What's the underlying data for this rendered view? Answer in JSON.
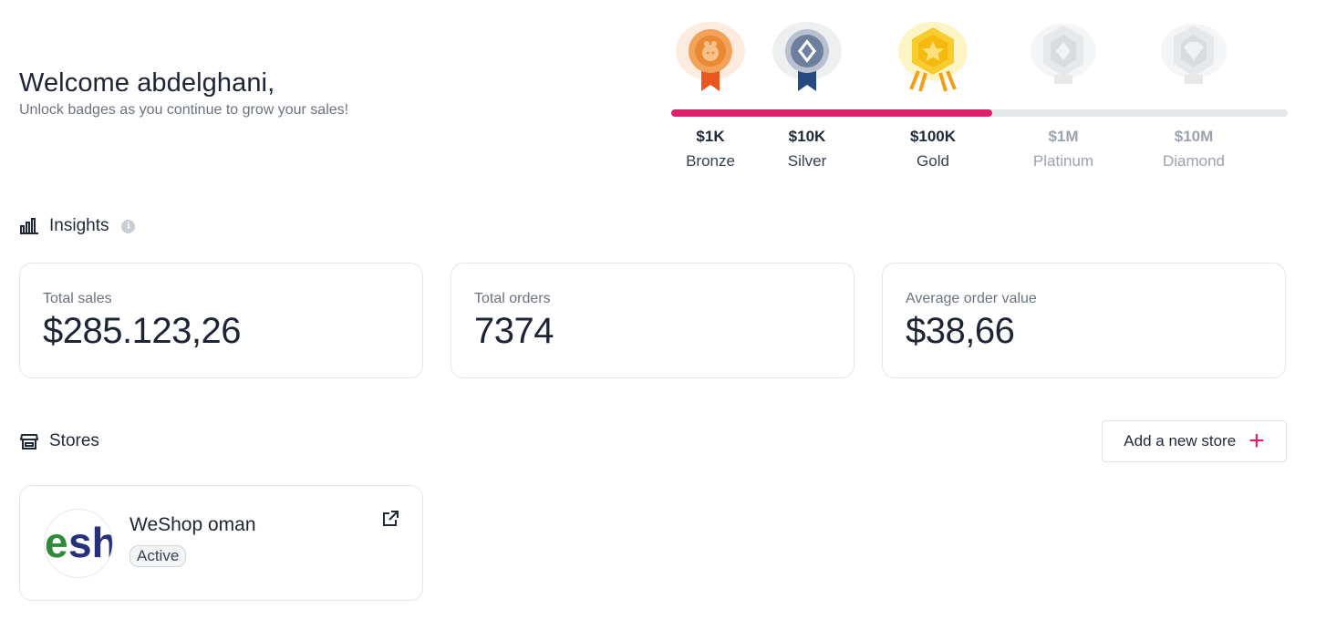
{
  "welcome": {
    "title": "Welcome abdelghani,",
    "subtitle": "Unlock badges as you continue to grow your sales!"
  },
  "badges": {
    "progress_fraction": 0.52,
    "items": [
      {
        "amount": "$1K",
        "tier": "Bronze",
        "unlocked": true,
        "icon": "bronze-medal-icon",
        "color": "#ec8f3d"
      },
      {
        "amount": "$10K",
        "tier": "Silver",
        "unlocked": true,
        "icon": "silver-medal-icon",
        "color": "#7b8aa6"
      },
      {
        "amount": "$100K",
        "tier": "Gold",
        "unlocked": true,
        "icon": "gold-medal-icon",
        "color": "#f5c21b"
      },
      {
        "amount": "$1M",
        "tier": "Platinum",
        "unlocked": false,
        "icon": "platinum-medal-icon",
        "color": "#e3e5e8"
      },
      {
        "amount": "$10M",
        "tier": "Diamond",
        "unlocked": false,
        "icon": "diamond-medal-icon",
        "color": "#e3e5e8"
      }
    ]
  },
  "insights": {
    "title": "Insights",
    "info_icon": "info-icon",
    "cards": [
      {
        "label": "Total sales",
        "value": "$285.123,26"
      },
      {
        "label": "Total orders",
        "value": "7374"
      },
      {
        "label": "Average order value",
        "value": "$38,66"
      }
    ]
  },
  "stores": {
    "title": "Stores",
    "add_button_label": "Add a new store",
    "items": [
      {
        "name": "WeShop oman",
        "status": "Active",
        "logo_text": "esh"
      }
    ]
  },
  "colors": {
    "accent": "#dd1f6c",
    "text": "#1e2433",
    "muted": "#6b7280",
    "border": "#e3e5e8"
  }
}
